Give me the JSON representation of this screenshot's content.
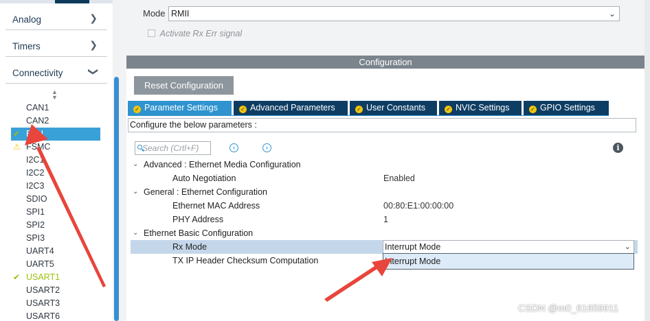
{
  "sidebar": {
    "categories": {
      "analog": "Analog",
      "timers": "Timers",
      "connectivity": "Connectivity"
    },
    "peripherals": [
      "CAN1",
      "CAN2",
      "ETH",
      "FSMC",
      "I2C1",
      "I2C2",
      "I2C3",
      "SDIO",
      "SPI1",
      "SPI2",
      "SPI3",
      "UART4",
      "UART5",
      "USART1",
      "USART2",
      "USART3",
      "USART6"
    ],
    "selected": "ETH",
    "status_icons": {
      "ETH": "check-icon",
      "FSMC": "warning-icon",
      "USART1": "check-icon"
    },
    "colors": {
      "selected_bg": "#3aa0d8",
      "ok_green": "#9ac00a",
      "warning": "#f2c500"
    }
  },
  "mode": {
    "label": "Mode",
    "value": "RMII",
    "activate_rx_err": {
      "label": "Activate Rx Err signal",
      "checked": false
    }
  },
  "configuration": {
    "header": "Configuration",
    "reset_button": "Reset Configuration",
    "tabs": [
      "Parameter Settings",
      "Advanced Parameters",
      "User Constants",
      "NVIC Settings",
      "GPIO Settings"
    ],
    "active_tab": "Parameter Settings",
    "instruction": "Configure the below parameters :",
    "search_placeholder": "Search (Crtl+F)",
    "groups": [
      {
        "title": "Advanced : Ethernet Media Configuration",
        "params": [
          {
            "name": "Auto Negotiation",
            "value": "Enabled"
          }
        ]
      },
      {
        "title": "General : Ethernet Configuration",
        "params": [
          {
            "name": "Ethernet MAC Address",
            "value": "00:80:E1:00:00:00"
          },
          {
            "name": "PHY Address",
            "value": "1"
          }
        ]
      },
      {
        "title": "Ethernet Basic Configuration",
        "params": [
          {
            "name": "Rx Mode",
            "value": "Interrupt Mode"
          },
          {
            "name": "TX IP Header Checksum Computation",
            "value": ""
          }
        ]
      }
    ],
    "rx_mode_dropdown_option": "Interrupt Mode"
  },
  "watermark": "CSDN @m0_61659911",
  "colors": {
    "tab_dark": "#0e3d63",
    "tab_active": "#2f93cf",
    "annotation_red": "#e8453c"
  }
}
